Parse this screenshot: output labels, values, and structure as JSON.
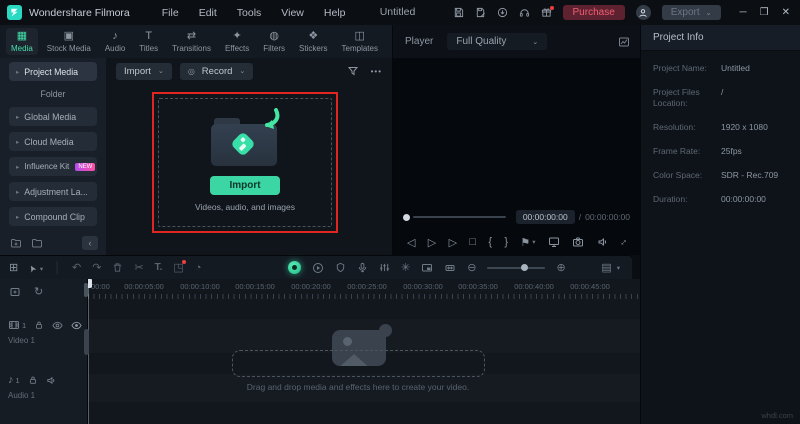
{
  "titlebar": {
    "app_name": "Wondershare Filmora",
    "menus": [
      "File",
      "Edit",
      "Tools",
      "View",
      "Help"
    ],
    "project_title": "Untitled",
    "purchase_label": "Purchase",
    "export_label": "Export"
  },
  "tabs": [
    {
      "label": "Media",
      "icon": "▦",
      "active": true
    },
    {
      "label": "Stock Media",
      "icon": "▣"
    },
    {
      "label": "Audio",
      "icon": "♪"
    },
    {
      "label": "Titles",
      "icon": "T"
    },
    {
      "label": "Transitions",
      "icon": "⇄"
    },
    {
      "label": "Effects",
      "icon": "✦"
    },
    {
      "label": "Filters",
      "icon": "◍"
    },
    {
      "label": "Stickers",
      "icon": "❖"
    },
    {
      "label": "Templates",
      "icon": "◫"
    }
  ],
  "sidebar": {
    "items": [
      {
        "label": "Project Media"
      },
      {
        "label": "Folder"
      },
      {
        "label": "Global Media"
      },
      {
        "label": "Cloud Media"
      },
      {
        "label": "Influence Kit",
        "badge": "NEW"
      },
      {
        "label": "Adjustment La..."
      },
      {
        "label": "Compound Clip"
      }
    ]
  },
  "media_panel": {
    "import_dropdown": "Import",
    "record_dropdown": "Record",
    "import_button": "Import",
    "import_hint": "Videos, audio, and images"
  },
  "player": {
    "label": "Player",
    "quality": "Full Quality",
    "current_time": "00:00:00:00",
    "separator": "/",
    "total_time": "00:00:00:00"
  },
  "project_info": {
    "title": "Project Info",
    "fields": [
      {
        "label": "Project Name:",
        "value": "Untitled"
      },
      {
        "label": "Project Files Location:",
        "value": "/"
      },
      {
        "label": "Resolution:",
        "value": "1920 x 1080"
      },
      {
        "label": "Frame Rate:",
        "value": "25fps"
      },
      {
        "label": "Color Space:",
        "value": "SDR - Rec.709"
      },
      {
        "label": "Duration:",
        "value": "00:00:00:00"
      }
    ]
  },
  "timeline": {
    "ruler_labels": [
      "00:00",
      "00:00:05:00",
      "00:00:10:00",
      "00:00:15:00",
      "00:00:20:00",
      "00:00:25:00",
      "00:00:30:00",
      "00:00:35:00",
      "00:00:40:00",
      "00:00:45:00"
    ],
    "tracks": [
      {
        "label": "Video 1",
        "num": "1"
      },
      {
        "label": "Audio 1",
        "num": "1"
      }
    ],
    "drop_hint": "Drag and drop media and effects here to create your video."
  },
  "watermark": "whdl.com",
  "colors": {
    "accent": "#3bd6a3",
    "annotation_red": "#e12521",
    "badge_pink": "#ff4fa0"
  },
  "glyphs": {
    "caret_down": "⌄",
    "chevron_right": "▸",
    "collapse_left": "‹",
    "more": "•••",
    "minimize": "─",
    "restore": "❐",
    "close": "✕",
    "record_dot": "◎",
    "grid": "⊞",
    "pointer": "➤",
    "pointer_caret": "▾",
    "divider": "│",
    "undo": "↶",
    "redo": "↷",
    "scissors": "✂",
    "text_tool": "T.",
    "crop": "◳",
    "dial": "◔",
    "freeze": "✳",
    "keyframe": "◇",
    "zoom_out": "⊖",
    "zoom_in": "⊕",
    "tracks_btn": "▤",
    "tracks_caret": "▾",
    "step_back": "◁",
    "play": "▷",
    "step_fwd": "▷",
    "stop": "□",
    "mark_in": "{",
    "mark_out": "}",
    "flag": "⚑",
    "refresh": "↻",
    "music_note": "♪",
    "fullscreen": "↕"
  }
}
